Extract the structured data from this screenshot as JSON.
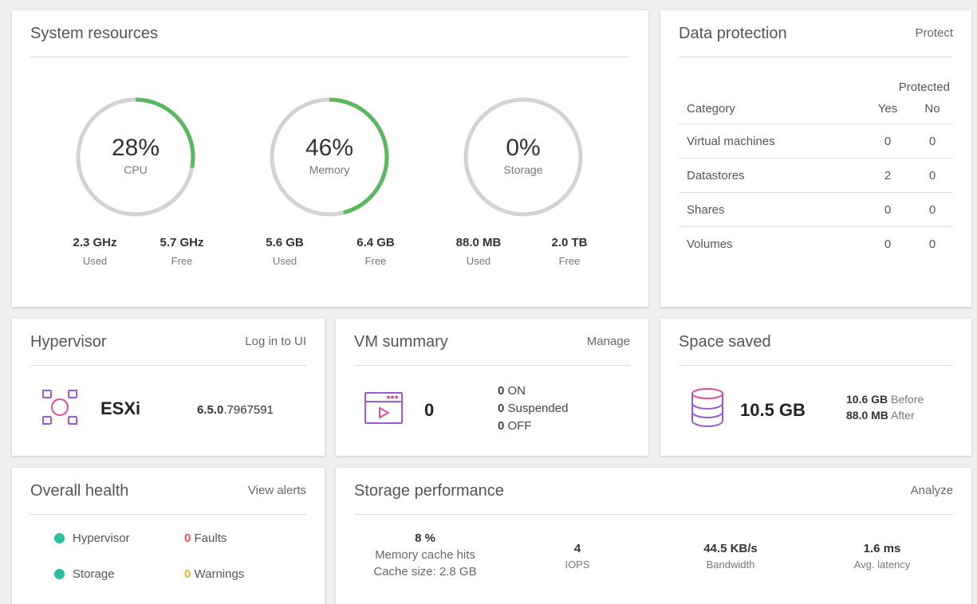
{
  "system_resources": {
    "title": "System resources",
    "gauges": [
      {
        "pct": "28%",
        "label": "CPU",
        "fraction": 0.28,
        "used_value": "2.3 GHz",
        "used_label": "Used",
        "free_value": "5.7 GHz",
        "free_label": "Free"
      },
      {
        "pct": "46%",
        "label": "Memory",
        "fraction": 0.46,
        "used_value": "5.6 GB",
        "used_label": "Used",
        "free_value": "6.4 GB",
        "free_label": "Free"
      },
      {
        "pct": "0%",
        "label": "Storage",
        "fraction": 0.0,
        "used_value": "88.0 MB",
        "used_label": "Used",
        "free_value": "2.0 TB",
        "free_label": "Free"
      }
    ],
    "colors": {
      "arc": "#5cb85c",
      "track": "#d3d3d3"
    }
  },
  "data_protection": {
    "title": "Data protection",
    "action": "Protect",
    "header_group": "Protected",
    "col_category": "Category",
    "col_yes": "Yes",
    "col_no": "No",
    "rows": [
      {
        "category": "Virtual machines",
        "yes": "0",
        "no": "0"
      },
      {
        "category": "Datastores",
        "yes": "2",
        "no": "0"
      },
      {
        "category": "Shares",
        "yes": "0",
        "no": "0"
      },
      {
        "category": "Volumes",
        "yes": "0",
        "no": "0"
      }
    ]
  },
  "hypervisor": {
    "title": "Hypervisor",
    "action": "Log in to UI",
    "name": "ESXi",
    "version_bold": "6.5.0",
    "version_rest": ".7967591",
    "icon": "hypervisor-icon"
  },
  "vm_summary": {
    "title": "VM summary",
    "action": "Manage",
    "total": "0",
    "on_count": "0",
    "on_label": "ON",
    "suspended_count": "0",
    "suspended_label": "Suspended",
    "off_count": "0",
    "off_label": "OFF",
    "icon": "vm-console-icon"
  },
  "space_saved": {
    "title": "Space saved",
    "value": "10.5 GB",
    "before_value": "10.6 GB",
    "before_label": "Before",
    "after_value": "88.0 MB",
    "after_label": "After",
    "icon": "database-icon"
  },
  "overall_health": {
    "title": "Overall health",
    "action": "View alerts",
    "items": [
      {
        "name": "Hypervisor",
        "count": "0",
        "count_label": "Faults",
        "count_color": "#e8505b"
      },
      {
        "name": "Storage",
        "count": "0",
        "count_label": "Warnings",
        "count_color": "#f0b429"
      }
    ],
    "dot_color": "#2bbfa0"
  },
  "storage_performance": {
    "title": "Storage performance",
    "action": "Analyze",
    "cache_pct": "8 %",
    "cache_label": "Memory cache hits",
    "cache_size": "Cache size: 2.8 GB",
    "iops_value": "4",
    "iops_label": "IOPS",
    "bandwidth_value": "44.5 KB/s",
    "bandwidth_label": "Bandwidth",
    "latency_value": "1.6 ms",
    "latency_label": "Avg. latency"
  }
}
